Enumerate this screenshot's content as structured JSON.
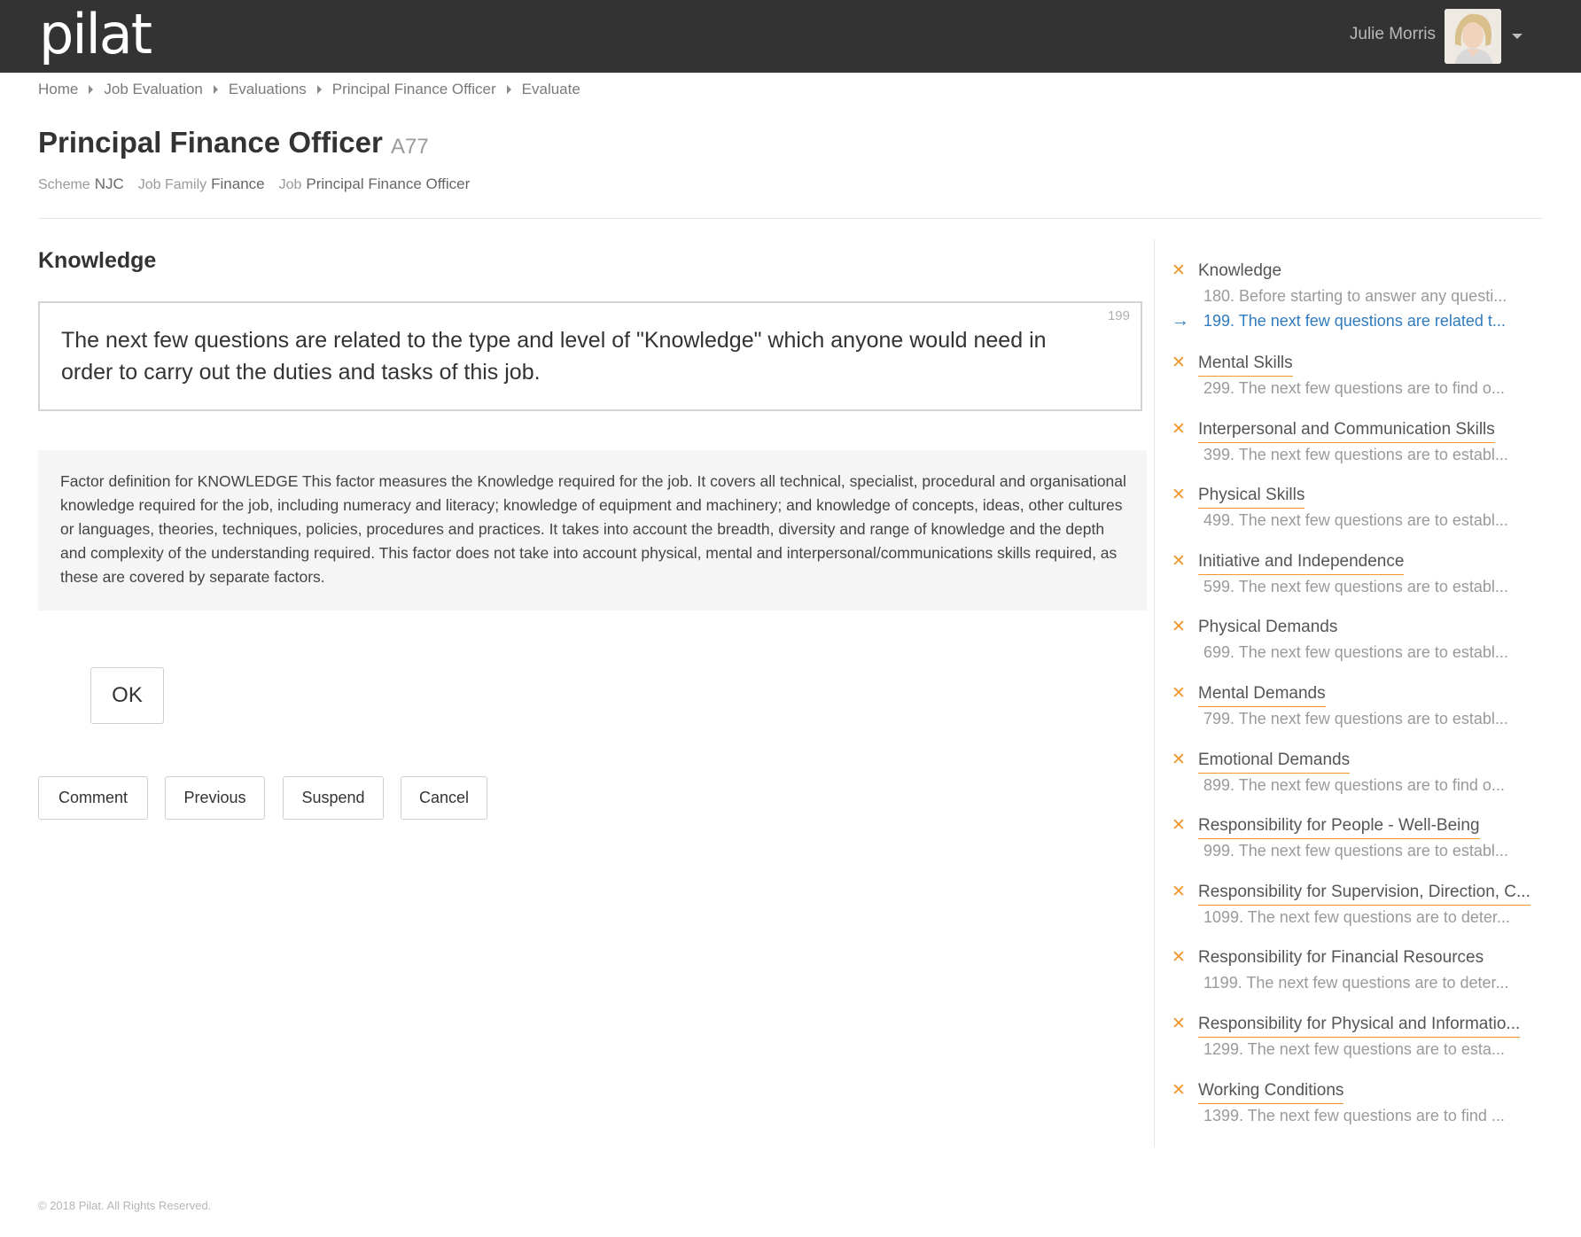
{
  "header": {
    "logo": "pilat",
    "user_name": "Julie Morris"
  },
  "breadcrumb": [
    "Home",
    "Job Evaluation",
    "Evaluations",
    "Principal Finance Officer",
    "Evaluate"
  ],
  "page": {
    "title": "Principal Finance Officer",
    "code": "A77",
    "meta": {
      "scheme_label": "Scheme",
      "scheme_value": "NJC",
      "family_label": "Job Family",
      "family_value": "Finance",
      "job_label": "Job",
      "job_value": "Principal Finance Officer"
    }
  },
  "section": {
    "title": "Knowledge",
    "question_number": "199",
    "question_text": "The next few questions are related to the type and level of \"Knowledge\" which anyone would need in order to carry out the duties and tasks of this job.",
    "definition": "Factor definition for KNOWLEDGE This factor measures the Knowledge required for the job. It covers all technical, specialist, procedural and organisational knowledge required for the job, including numeracy and literacy; knowledge of equipment and machinery; and knowledge of concepts, ideas, other cultures or languages, theories, techniques, policies, procedures and practices. It takes into account the breadth, diversity and range of knowledge and the depth and complexity of the understanding required. This factor does not take into account physical, mental and interpersonal/communications skills required, as these are covered by separate factors."
  },
  "buttons": {
    "ok": "OK",
    "comment": "Comment",
    "previous": "Previous",
    "suspend": "Suspend",
    "cancel": "Cancel"
  },
  "nav": {
    "knowledge": {
      "title": "Knowledge",
      "sub1": "180. Before starting to answer any questi...",
      "sub2": "199. The next few questions are related t..."
    },
    "items": [
      {
        "title": "Mental Skills",
        "sub": "299. The next few questions are to find o..."
      },
      {
        "title": "Interpersonal and Communication Skills",
        "sub": "399. The next few questions are to establ..."
      },
      {
        "title": "Physical Skills",
        "sub": "499. The next few questions are to establ..."
      },
      {
        "title": "Initiative and Independence",
        "sub": "599. The next few questions are to establ..."
      },
      {
        "title": "Physical Demands",
        "sub": "699. The next few questions are to establ..."
      },
      {
        "title": "Mental Demands",
        "sub": "799. The next few questions are to establ..."
      },
      {
        "title": "Emotional Demands",
        "sub": "899. The next few questions are to find o..."
      },
      {
        "title": "Responsibility for People - Well-Being",
        "sub": "999. The next few questions are to establ..."
      },
      {
        "title": "Responsibility for Supervision, Direction, C...",
        "sub": "1099. The next few questions are to deter..."
      },
      {
        "title": "Responsibility for Financial Resources",
        "sub": "1199. The next few questions are to deter..."
      },
      {
        "title": "Responsibility for Physical and Informatio...",
        "sub": "1299. The next few questions are to esta..."
      },
      {
        "title": "Working Conditions",
        "sub": "1399. The next few questions are to find ..."
      }
    ]
  },
  "footer": "© 2018 Pilat. All Rights Reserved.",
  "colors": {
    "topbar": "#333333",
    "accent_orange": "#f0972e",
    "accent_blue": "#2f7bbf"
  },
  "icons": {
    "nav_status": "close-icon",
    "current_question": "arrow-right-icon"
  }
}
